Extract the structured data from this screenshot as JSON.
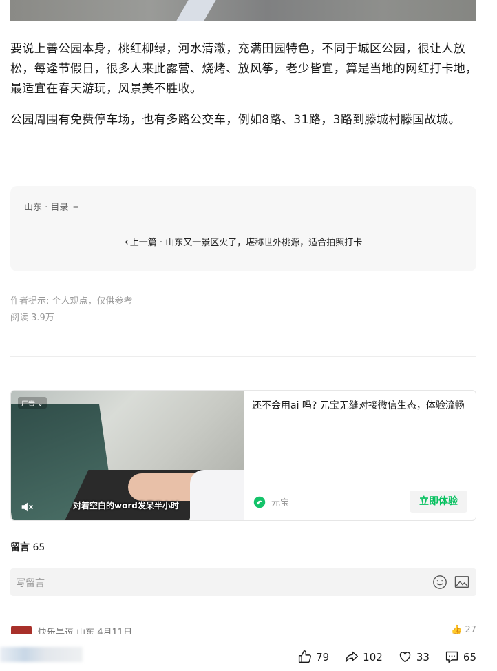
{
  "article": {
    "paragraph1": "要说上善公园本身，桃红柳绿，河水清澈，充满田园特色，不同于城区公园，很让人放松，每逢节假日，很多人来此露营、烧烤、放风筝，老少皆宜，算是当地的网红打卡地，最适宜在春天游玩，风景美不胜收。",
    "paragraph2": "公园周围有免费停车场，也有多路公交车，例如8路、31路，3路到滕城村滕国故城。"
  },
  "toc": {
    "header": "山东 · 目录",
    "menu_icon": "≡",
    "prev_label": "上一篇 · 山东又一景区火了，堪称世外桃源，适合拍照打卡"
  },
  "meta": {
    "author_note": "作者提示: 个人观点，仅供参考",
    "reads": "阅读 3.9万"
  },
  "ad": {
    "badge": "广告 ⌄",
    "subtitle": "对着空白的word发呆半小时",
    "title": "还不会用ai 吗? 元宝无缝对接微信生态，体验流畅",
    "brand": "元宝",
    "cta": "立即体验",
    "accent_color": "#07c160"
  },
  "comments": {
    "label": "留言",
    "count": "65",
    "placeholder": "写留言",
    "preview": {
      "text": "快乐昙逗  山东  4月11日",
      "likes": "27"
    }
  },
  "bottom_bar": {
    "like_count": "79",
    "share_count": "102",
    "favorite_count": "33",
    "comment_count": "65"
  }
}
